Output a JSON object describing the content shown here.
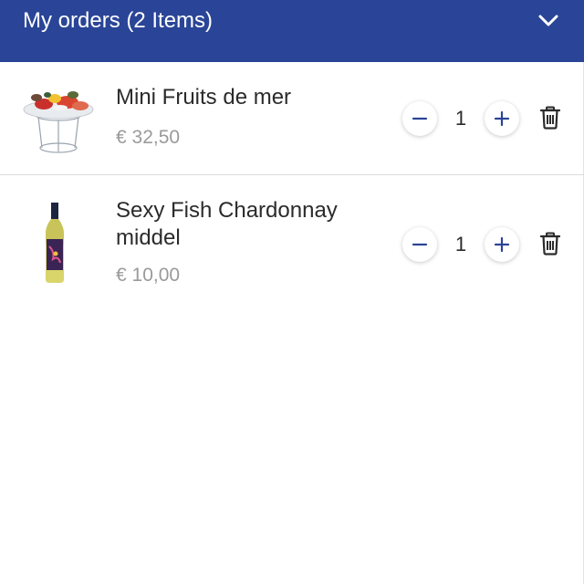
{
  "header": {
    "title": "My orders (2 Items)",
    "toggle_icon": "chevron-down-icon",
    "background": "#2a4597"
  },
  "orders": [
    {
      "name": "Mini Fruits de mer",
      "price": "€ 32,50",
      "quantity": "1",
      "image": "seafood-platter"
    },
    {
      "name": "Sexy Fish Chardonnay middel",
      "price": "€ 10,00",
      "quantity": "1",
      "image": "wine-bottle"
    }
  ],
  "colors": {
    "accent": "#2a4597",
    "price": "#9a9a9a",
    "text": "#2b2b2b"
  }
}
